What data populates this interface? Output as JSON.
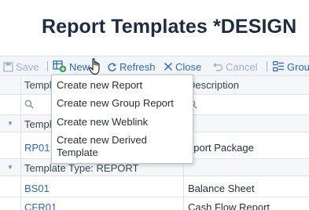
{
  "page": {
    "title": "Report Templates *DESIGN"
  },
  "toolbar": {
    "save": "Save",
    "new": "New",
    "refresh": "Refresh",
    "close": "Close",
    "cancel": "Cancel",
    "group": "Grou"
  },
  "grid": {
    "columns": [
      "Templ",
      "Description"
    ],
    "groups": [
      {
        "label": "Templ",
        "rows": [
          {
            "code": "RP01",
            "description": "eport Package"
          }
        ]
      },
      {
        "label": "Template Type: REPORT",
        "rows": [
          {
            "code": "BS01",
            "description": "Balance Sheet"
          },
          {
            "code": "CFR01",
            "description": "Cash Flow Report"
          }
        ]
      }
    ]
  },
  "new_menu": {
    "items": [
      "Create new Report",
      "Create new Group Report",
      "Create new Weblink",
      "Create new Derived Template"
    ]
  },
  "colors": {
    "accent": "#2b69c4",
    "title": "#1c2c44",
    "toolbar_bg": "#f3f6f9"
  }
}
